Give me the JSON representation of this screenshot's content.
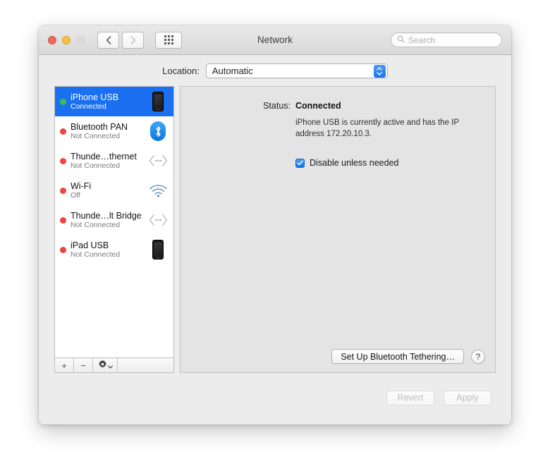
{
  "window": {
    "title": "Network",
    "traffic_lights": [
      "close-button",
      "minimize-button",
      "zoom-button"
    ],
    "nav": {
      "back": "back-icon",
      "forward": "forward-icon"
    },
    "grid_button": "show-all-preferences-icon",
    "search": {
      "placeholder": "Search",
      "value": "",
      "icon": "search-icon"
    }
  },
  "location": {
    "label": "Location:",
    "value": "Automatic",
    "options": [
      "Automatic"
    ]
  },
  "sidebar": {
    "services": [
      {
        "name": "iPhone USB",
        "status": "Connected",
        "dot": "green",
        "icon": "iphone-icon",
        "selected": true
      },
      {
        "name": "Bluetooth PAN",
        "status": "Not Connected",
        "dot": "red",
        "icon": "bluetooth-icon",
        "selected": false
      },
      {
        "name": "Thunde…thernet",
        "status": "Not Connected",
        "dot": "red",
        "icon": "thunderbolt-icon",
        "selected": false
      },
      {
        "name": "Wi-Fi",
        "status": "Off",
        "dot": "red",
        "icon": "wifi-icon",
        "selected": false
      },
      {
        "name": "Thunde…lt Bridge",
        "status": "Not Connected",
        "dot": "red",
        "icon": "thunderbolt-icon",
        "selected": false
      },
      {
        "name": "iPad USB",
        "status": "Not Connected",
        "dot": "red",
        "icon": "ipad-icon",
        "selected": false
      }
    ],
    "toolbar": {
      "add": "+",
      "remove": "−",
      "actions": "gear-icon"
    }
  },
  "detail": {
    "status_key": "Status:",
    "status_value": "Connected",
    "status_description": "iPhone USB is currently active and has the IP address 172.20.10.3.",
    "checkbox_label": "Disable unless needed",
    "checkbox_checked": true,
    "tethering_button": "Set Up Bluetooth Tethering…",
    "help_button": "?"
  },
  "footer": {
    "revert": "Revert",
    "apply": "Apply",
    "revert_enabled": false,
    "apply_enabled": false
  },
  "colors": {
    "selection_blue": "#1a70f0",
    "connected_green": "#3fc04b",
    "disconnected_red": "#f0453f",
    "accent_blue": "#1675e8",
    "window_chrome": "#ececec",
    "panel_gray": "#e4e4e4"
  }
}
